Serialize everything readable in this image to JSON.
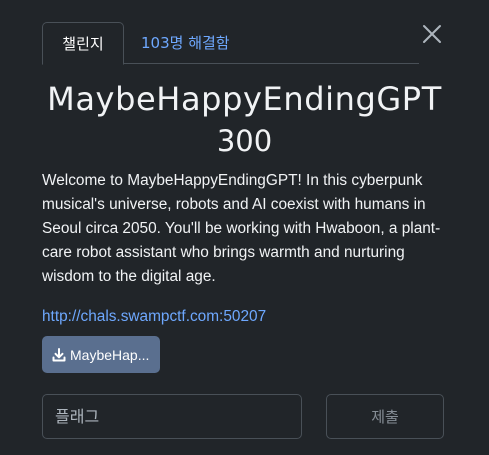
{
  "tabs": {
    "challenge_label": "챌린지",
    "solves_label": "103명 해결함"
  },
  "challenge": {
    "name": "MaybeHappyEndingGPT",
    "points": "300",
    "description": "Welcome to MaybeHappyEndingGPT! In this cyberpunk musical's universe, robots and AI coexist with humans in Seoul circa 2050. You'll be working with Hwaboon, a plant-care robot assistant who brings warmth and nurturing wisdom to the digital age.",
    "link": "http://chals.swampctf.com:50207",
    "file_label": "MaybeHap..."
  },
  "flag_form": {
    "placeholder": "플래그",
    "submit_label": "제출"
  },
  "icons": {
    "close": "close-icon",
    "download": "download-icon"
  },
  "colors": {
    "background": "#212529",
    "link": "#6ea8fe",
    "file_button": "#5a6f8f",
    "border": "#495057"
  }
}
